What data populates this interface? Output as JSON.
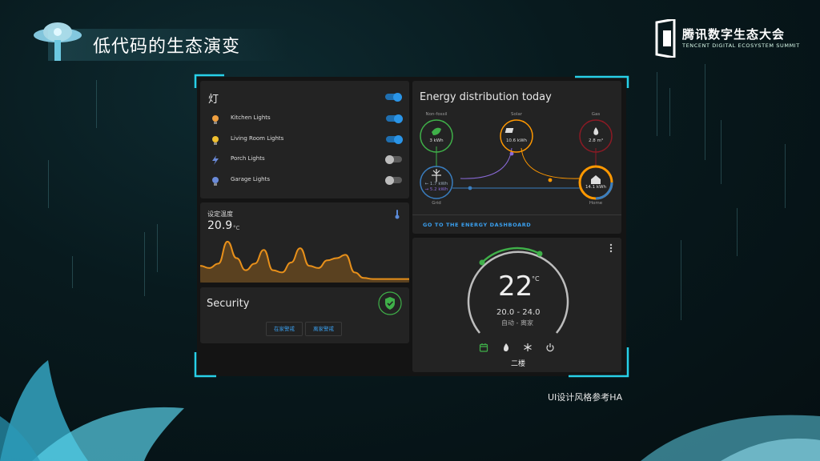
{
  "slide": {
    "title": "低代码的生态演变",
    "brand_zh": "腾讯数字生态大会",
    "brand_en": "TENCENT DIGITAL ECOSYSTEM SUMMIT",
    "caption": "UI设计风格参考HA"
  },
  "lights": {
    "title": "灯",
    "master_on": true,
    "items": [
      {
        "label": "Kitchen Lights",
        "on": true,
        "icon": "bulb-icon",
        "color": "#f0a040"
      },
      {
        "label": "Living Room Lights",
        "on": true,
        "icon": "bulb-icon",
        "color": "#f0c030"
      },
      {
        "label": "Porch Lights",
        "on": false,
        "icon": "lightning-icon",
        "color": "#6a8ad8"
      },
      {
        "label": "Garage Lights",
        "on": false,
        "icon": "bulb-icon",
        "color": "#6a8ad8"
      }
    ]
  },
  "temperature": {
    "label": "设定温度",
    "value": "20.9",
    "unit": "°C",
    "icon": "thermometer-icon",
    "line_color": "#e8901a",
    "history": [
      26,
      22,
      30,
      70,
      40,
      18,
      30,
      55,
      18,
      14,
      32,
      58,
      26,
      22,
      36,
      40,
      46,
      14,
      4,
      2,
      2,
      2,
      2,
      2
    ]
  },
  "security": {
    "title": "Security",
    "icon": "shield-check-icon",
    "buttons": [
      "在家警戒",
      "离家警戒"
    ]
  },
  "energy": {
    "title": "Energy distribution today",
    "link": "GO TO THE ENERGY DASHBOARD",
    "nodes": {
      "non_fossil": {
        "label": "Non-fossil",
        "value": "3 kWh",
        "icon": "leaf-icon",
        "color": "#3fb049"
      },
      "solar": {
        "label": "Solar",
        "value": "10.6 kWh",
        "icon": "solar-panel-icon",
        "color": "#ff9800"
      },
      "gas": {
        "label": "Gas",
        "value": "2.8 m³",
        "icon": "flame-icon",
        "color": "#8b1a24"
      },
      "grid": {
        "label": "Grid",
        "value_in": "← 1.7 kWh",
        "value_out": "→ 5.2 kWh",
        "icon": "transmission-tower-icon",
        "color": "#3a7ec0"
      },
      "home": {
        "label": "Home",
        "value": "14.1 kWh",
        "icon": "home-icon",
        "color": "#ff9800"
      }
    }
  },
  "thermostat": {
    "temperature": "22",
    "unit": "°C",
    "range": "20.0 - 24.0",
    "mode": "自动 - 离家",
    "name": "二楼",
    "menu_icon": "more-vert-icon",
    "modes": [
      {
        "icon": "calendar-auto-icon",
        "active": true
      },
      {
        "icon": "flame-icon",
        "active": false
      },
      {
        "icon": "snowflake-icon",
        "active": false
      },
      {
        "icon": "power-icon",
        "active": false
      }
    ],
    "accent": "#3fb049"
  }
}
